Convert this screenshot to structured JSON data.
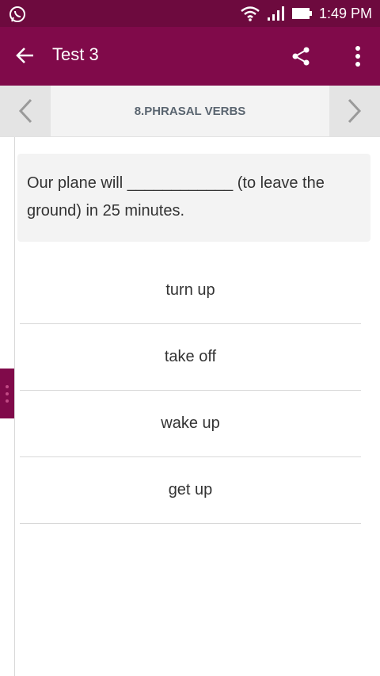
{
  "status_bar": {
    "time": "1:49 PM",
    "icons": [
      "whatsapp-icon",
      "wifi-icon",
      "signal-icon",
      "battery-icon"
    ]
  },
  "app_bar": {
    "title": "Test 3",
    "icons": [
      "back-arrow-icon",
      "share-icon",
      "more-vert-icon"
    ]
  },
  "nav": {
    "section_title": "8.PHRASAL VERBS"
  },
  "question": {
    "text": "Our plane will ____________ (to leave the ground) in 25 minutes."
  },
  "options": [
    {
      "label": "turn up"
    },
    {
      "label": "take off"
    },
    {
      "label": "wake up"
    },
    {
      "label": "get up"
    }
  ],
  "colors": {
    "status_bar": "#6d0a3e",
    "app_bar": "#800a4a",
    "section_title": "#5a6570"
  }
}
